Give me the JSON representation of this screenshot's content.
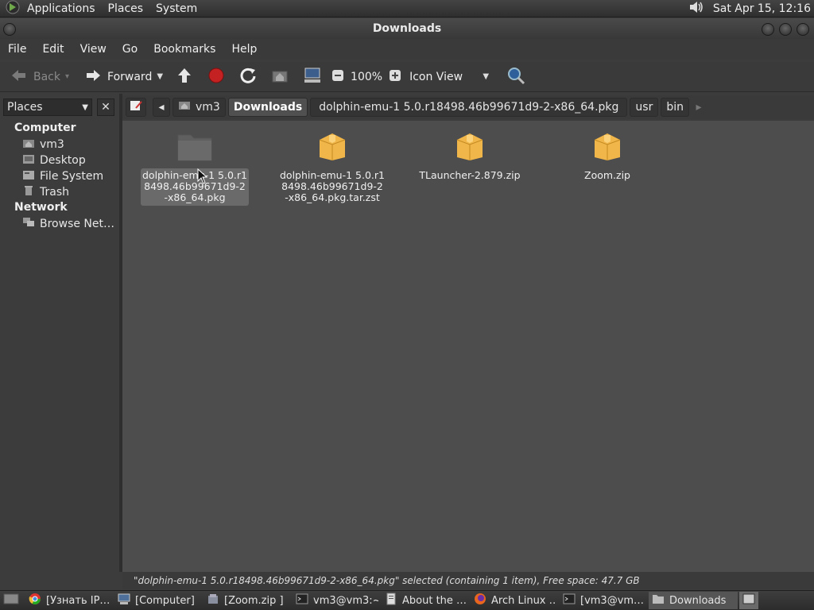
{
  "top_panel": {
    "menus": [
      "Applications",
      "Places",
      "System"
    ],
    "clock": "Sat Apr 15, 12:16"
  },
  "window": {
    "title": "Downloads"
  },
  "menubar": [
    "File",
    "Edit",
    "View",
    "Go",
    "Bookmarks",
    "Help"
  ],
  "toolbar": {
    "back": "Back",
    "forward": "Forward",
    "zoom": "100%",
    "view_mode": "Icon View"
  },
  "location": {
    "crumbs": [
      "vm3",
      "Downloads",
      "dolphin-emu-1 5.0.r18498.46b99671d9-2-x86_64.pkg",
      "usr",
      "bin"
    ]
  },
  "sidebar": {
    "selector": "Places",
    "sections": [
      {
        "title": "Computer",
        "items": [
          "vm3",
          "Desktop",
          "File System",
          "Trash"
        ]
      },
      {
        "title": "Network",
        "items": [
          "Browse Net…"
        ]
      }
    ]
  },
  "files": [
    {
      "name": "dolphin-emu-1 5.0.r18498.46b99671d9-2-x86_64.pkg",
      "kind": "folder",
      "selected": true
    },
    {
      "name": "dolphin-emu-1 5.0.r18498.46b99671d9-2-x86_64.pkg.tar.zst",
      "kind": "archive"
    },
    {
      "name": "TLauncher-2.879.zip",
      "kind": "archive"
    },
    {
      "name": "Zoom.zip",
      "kind": "archive"
    }
  ],
  "status": "\"dolphin-emu-1 5.0.r18498.46b99671d9-2-x86_64.pkg\" selected (containing 1 item), Free space: 47.7 GB",
  "taskbar": [
    {
      "label": "[Узнать IP…",
      "icon": "chrome-icon"
    },
    {
      "label": "[Computer]",
      "icon": "computer-icon"
    },
    {
      "label": "[Zoom.zip ]",
      "icon": "archive-manager-icon"
    },
    {
      "label": "vm3@vm3:~",
      "icon": "terminal-icon"
    },
    {
      "label": "About the …",
      "icon": "document-icon"
    },
    {
      "label": "Arch Linux …",
      "icon": "firefox-icon"
    },
    {
      "label": "[vm3@vm…",
      "icon": "terminal-icon"
    },
    {
      "label": "Downloads",
      "icon": "folder-icon",
      "active": true
    }
  ]
}
